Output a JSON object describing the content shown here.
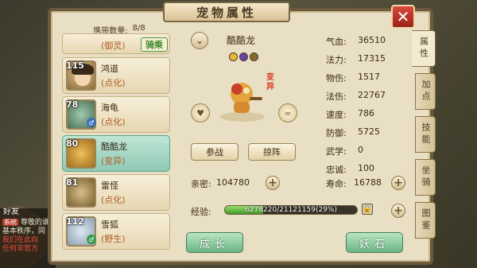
{
  "title": "宠物属性",
  "carry": {
    "label": "携带数量:",
    "value": "8/8"
  },
  "ride_tag": "骑乘",
  "pets": [
    {
      "level": "",
      "name": "",
      "type": "(御灵)",
      "ride": true
    },
    {
      "level": "115",
      "name": "鸿道",
      "type": "(点化)"
    },
    {
      "level": "78",
      "name": "海龟",
      "type": "(点化)"
    },
    {
      "level": "80",
      "name": "酷酷龙",
      "type": "(变异)",
      "active": true
    },
    {
      "level": "81",
      "name": "雷怪",
      "type": "(点化)"
    },
    {
      "level": "112",
      "name": "雪狐",
      "type": "(野生)"
    }
  ],
  "current_pet": {
    "name": "酷酷龙",
    "change_tag": "变异"
  },
  "buttons": {
    "fight": "参战",
    "formation": "掠阵",
    "grow": "成长",
    "stone": "妖石"
  },
  "stats": [
    {
      "label": "气血:",
      "value": "36510"
    },
    {
      "label": "法力:",
      "value": "17315"
    },
    {
      "label": "物伤:",
      "value": "1517"
    },
    {
      "label": "法伤:",
      "value": "22767"
    },
    {
      "label": "速度:",
      "value": "786"
    },
    {
      "label": "防御:",
      "value": "5725"
    },
    {
      "label": "武学:",
      "value": "0"
    },
    {
      "label": "忠诚:",
      "value": "100"
    }
  ],
  "intimacy": {
    "label": "亲密:",
    "value": "104780"
  },
  "lifespan": {
    "label": "寿命:",
    "value": "16788"
  },
  "exp": {
    "label": "经验:",
    "text": "6278220/21121159(29%)",
    "fraction": 0.29
  },
  "tabs": [
    "属性",
    "加点",
    "技能",
    "坐骑",
    "图鉴"
  ],
  "chat": {
    "friend": "好友",
    "tag": "系统",
    "line1": "尊敬的谁",
    "line2": "基本秩序，同",
    "line3": "我们在此向",
    "line4": "任何非官方"
  },
  "close_icon": "close-icon",
  "colors": {
    "panel": "#e9dfc4",
    "active_item": "#8fcab4",
    "green_button": "#6cb488",
    "close": "#c0392b"
  }
}
